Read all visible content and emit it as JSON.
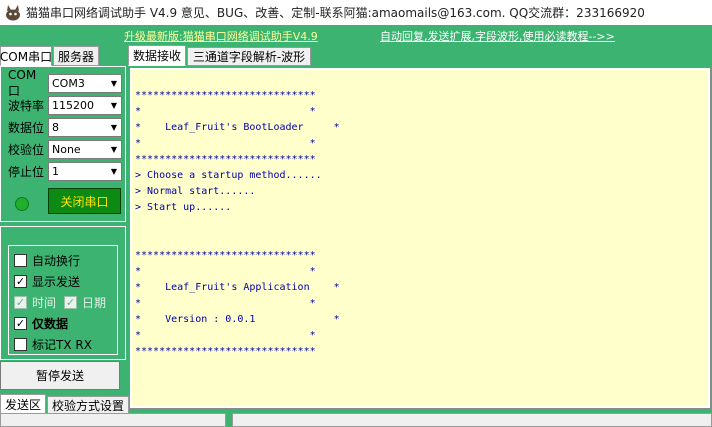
{
  "window": {
    "title": "猫猫串口网络调试助手 V4.9 意见、BUG、改善、定制-联系阿猫:amaomails@163.com. QQ交流群：233166920"
  },
  "links": {
    "upgrade": "升级最新版:猫猫串口网络调试助手V4.9",
    "help": "自动回复,发送扩展,字段波形,使用必读教程-->>"
  },
  "left_tabs": [
    {
      "label": "COM串口",
      "active": true
    },
    {
      "label": "服务器",
      "active": false
    }
  ],
  "main_tabs": [
    {
      "label": "数据接收",
      "active": true
    },
    {
      "label": "三通道字段解析-波形",
      "active": false
    }
  ],
  "serial": {
    "fields": [
      {
        "label": "COM口",
        "value": "COM3"
      },
      {
        "label": "波特率",
        "value": "115200"
      },
      {
        "label": "数据位",
        "value": "8"
      },
      {
        "label": "校验位",
        "value": "None"
      },
      {
        "label": "停止位",
        "value": "1"
      }
    ],
    "close_button": "关闭串口"
  },
  "options": {
    "auto_newline": {
      "label": "自动换行",
      "checked": false
    },
    "show_send": {
      "label": "显示发送",
      "checked": true
    },
    "time": {
      "label": "时间",
      "checked": true
    },
    "date": {
      "label": "日期",
      "checked": true
    },
    "data_only": {
      "label": "仅数据",
      "checked": true
    },
    "mark_txrx": {
      "label": "标记TX RX",
      "checked": false
    },
    "check_glyph": "✓"
  },
  "pause_button": "暂停发送",
  "bottom_tabs": [
    {
      "label": "发送区",
      "active": true
    },
    {
      "label": "校验方式设置",
      "active": false
    }
  ],
  "receive_text": "******************************\n*                            *\n*    Leaf_Fruit's BootLoader     *\n*                            *\n******************************\n> Choose a startup method......\n> Normal start......\n> Start up......\n\n\n******************************\n*                            *\n*    Leaf_Fruit's Application    *\n*                            *\n*    Version : 0.0.1             *\n*                            *\n******************************",
  "colors": {
    "panel_green": "#3cb371",
    "receive_bg": "#ffffcc",
    "receive_text": "#0000aa",
    "close_button_bg": "#0d8a14",
    "close_button_text": "#ffe300"
  }
}
